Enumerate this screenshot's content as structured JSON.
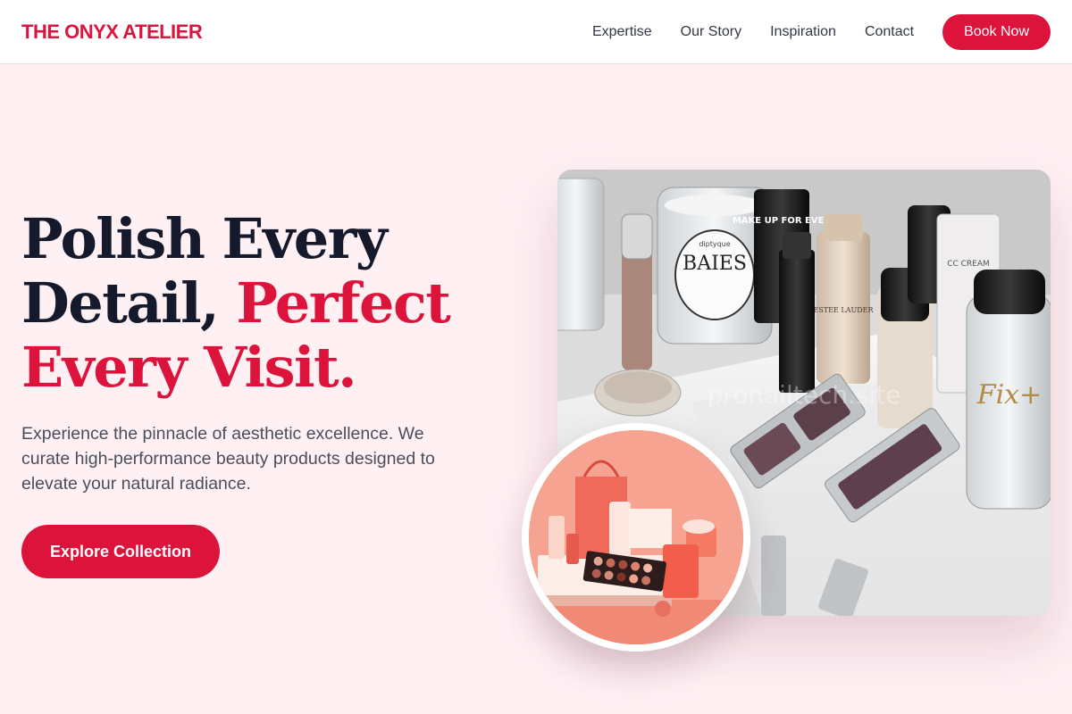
{
  "brand": {
    "name": "THE ONYX ATELIER"
  },
  "nav": {
    "links": [
      "Expertise",
      "Our Story",
      "Inspiration",
      "Contact"
    ],
    "book_label": "Book Now"
  },
  "hero": {
    "title_dark": "Polish Every Detail,",
    "title_accent_1": "Perfect",
    "title_accent_2": "Every Visit.",
    "subtitle": "Experience the pinnacle of aesthetic excellence. We curate high-performance beauty products designed to elevate your natural radiance.",
    "cta_label": "Explore Collection"
  },
  "images": {
    "main": {
      "candle_label": "BAIES",
      "candle_brand": "diptyque",
      "tube_label": "MAKE UP FOR EVER",
      "foundation_label": "ESTEE LAUDER",
      "cream_label": "CC CREAM",
      "spray_label": "Fix+",
      "watermark": "pronailtech.site"
    }
  },
  "colors": {
    "accent": "#dc143c",
    "background": "#fff0f4",
    "heading": "#141a2c",
    "body_text": "#4a4e5c"
  }
}
